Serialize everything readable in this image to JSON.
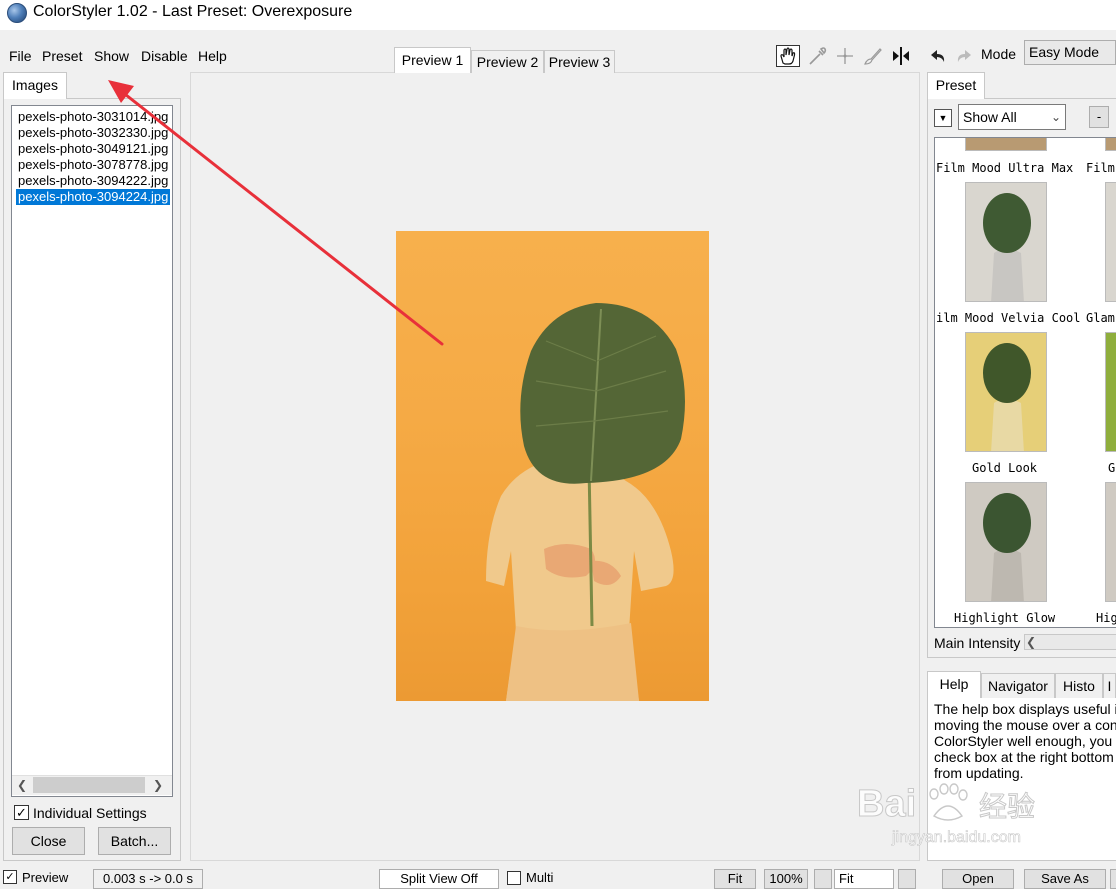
{
  "window": {
    "title": "ColorStyler 1.02 - Last Preset: Overexposure"
  },
  "menu": {
    "items": [
      "File",
      "Preset",
      "Show",
      "Disable",
      "Help"
    ]
  },
  "left_panel": {
    "tab_label": "Images",
    "files": [
      "pexels-photo-3031014.jpg",
      "pexels-photo-3032330.jpg",
      "pexels-photo-3049121.jpg",
      "pexels-photo-3078778.jpg",
      "pexels-photo-3094222.jpg",
      "pexels-photo-3094224.jpg"
    ],
    "selected_file": "pexels-photo-3094224.jpg",
    "individual_settings_label": "Individual Settings",
    "individual_settings_checked": true,
    "close_label": "Close",
    "batch_label": "Batch..."
  },
  "preview": {
    "tabs": [
      "Preview 1",
      "Preview 2",
      "Preview 3"
    ],
    "active_tab": "Preview 1"
  },
  "tools": [
    "hand-icon",
    "eyedropper-icon",
    "crosshair-icon",
    "brush-icon",
    "split-arrows-icon",
    "undo-icon",
    "redo-icon"
  ],
  "mode": {
    "label": "Mode",
    "value": "Easy Mode"
  },
  "preset_panel": {
    "tab_label": "Preset",
    "filter_value": "Show All",
    "minus_label": "-",
    "top_labels": [
      "Film Mood Ultra Max",
      "Film"
    ],
    "presets": [
      {
        "label": "ilm Mood Velvia Cool",
        "next_label": "Glam"
      },
      {
        "label": "Gold Look",
        "next_label": "G"
      },
      {
        "label": "Highlight Glow",
        "next_label": "Hig"
      }
    ],
    "intensity_label": "Main Intensity"
  },
  "help_panel": {
    "tabs": [
      "Help",
      "Navigator",
      "Histo",
      "I"
    ],
    "lines": [
      "The help box displays useful inf",
      "moving the mouse over a contr",
      "ColorStyler well enough, you ca",
      "check box at the right bottom to",
      "from updating."
    ]
  },
  "bottom_bar": {
    "preview_label": "Preview",
    "preview_checked": true,
    "timing": "0.003 s -> 0.0 s",
    "split_view": "Split View Off",
    "multi_label": "Multi",
    "fit_label": "Fit",
    "zoom": "100%",
    "fit_select": "Fit",
    "open_label": "Open",
    "saveas_label": "Save As"
  },
  "watermark": {
    "text": "Baidu经验",
    "url": "jingyan.baidu.com"
  },
  "colors": {
    "selection": "#0078d7",
    "annotation": "#e8303a",
    "photo_bg": "#f5aa45"
  }
}
